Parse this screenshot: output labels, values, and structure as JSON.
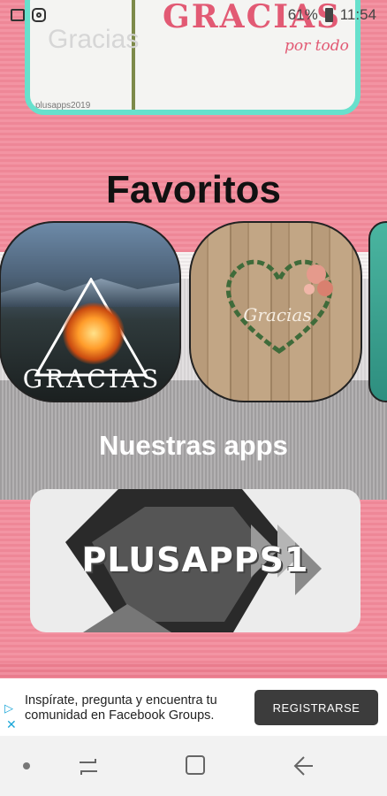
{
  "status_bar": {
    "battery_text": "61%",
    "time": "11:54",
    "icons": [
      "gallery-icon",
      "instagram-icon",
      "battery-icon"
    ]
  },
  "top_banner": {
    "faint_text": "Gracias",
    "title": "GRACIAS",
    "subtitle": "por todo",
    "watermark": "plusapps2019"
  },
  "favorites": {
    "title": "Favoritos",
    "items": [
      {
        "label": "GRACIAS"
      },
      {
        "label": "Gracias"
      }
    ]
  },
  "apps": {
    "title": "Nuestras apps",
    "items": [
      {
        "label": "PLUSAPPS1"
      }
    ]
  },
  "ad": {
    "text": "Inspírate, pregunta y encuentra tu comunidad en Facebook Groups.",
    "cta": "REGISTRARSE"
  },
  "colors": {
    "accent_teal": "#67e0cc",
    "brand_pink": "#e25a74",
    "ad_button": "#3c3c3c"
  }
}
